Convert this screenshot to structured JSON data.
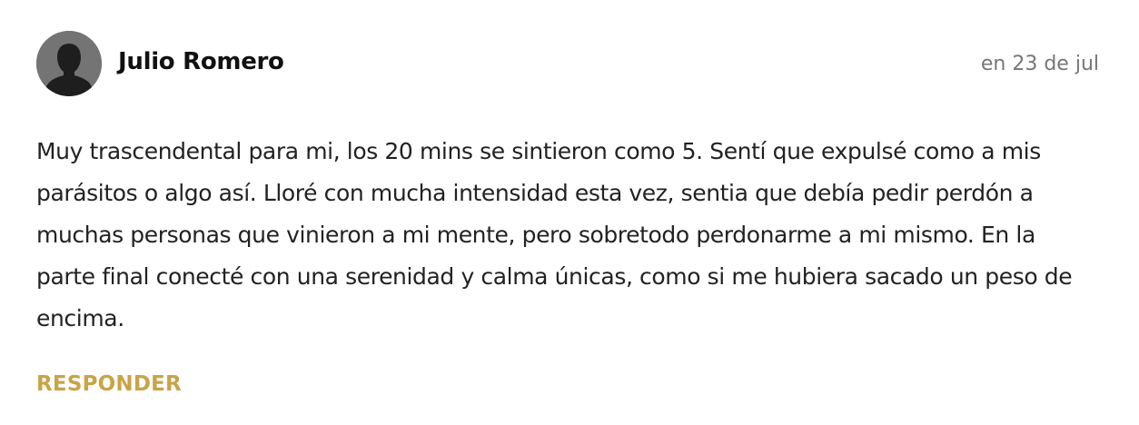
{
  "comment": {
    "author": "Julio Romero",
    "date": "en 23 de jul",
    "avatar_icon": "default-user-silhouette-icon",
    "text": "Muy trascendental para mi, los 20 mins se sintieron como 5. Sentí que expulsé como a mis parásitos o algo así. Lloré con mucha intensidad esta vez, sentia que debía pedir perdón a muchas personas que vinieron a mi mente, pero sobretodo perdonarme a mi mismo. En la parte final conecté con una serenidad y calma únicas, como si me hubiera sacado un peso de encima.",
    "reply_label": "RESPONDER"
  },
  "colors": {
    "accent": "#c9a447",
    "avatar_bg": "#747474",
    "avatar_silhouette": "#1e1e1e",
    "muted_text": "#767676"
  }
}
